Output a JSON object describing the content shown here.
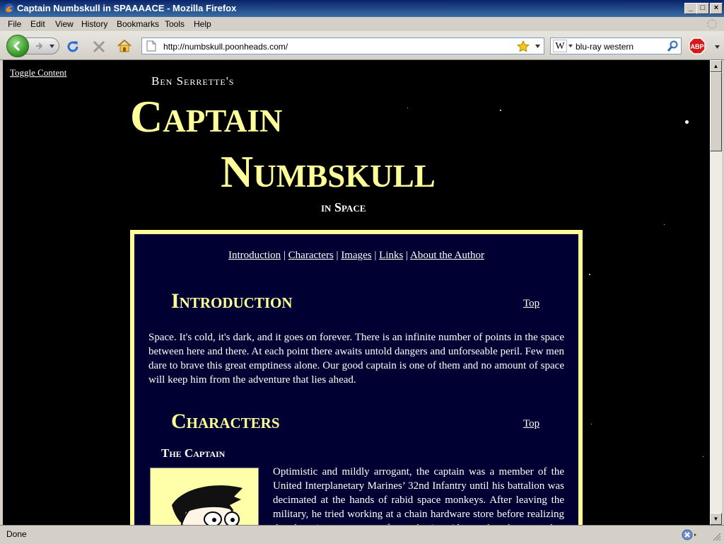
{
  "window": {
    "title": "Captain Numbskull in SPAAAACE - Mozilla Firefox"
  },
  "menu": [
    "File",
    "Edit",
    "View",
    "History",
    "Bookmarks",
    "Tools",
    "Help"
  ],
  "toolbar": {
    "url": "http://numbskull.poonheads.com/",
    "search_engine_letter": "W",
    "search_value": "blu-ray western"
  },
  "page": {
    "toggle_label": "Toggle Content",
    "byline": "Ben Serrette's",
    "title_line1": "Captain",
    "title_line2": "Numbskull",
    "title_line3": "in Space",
    "nav": [
      "Introduction",
      "Characters",
      "Images",
      "Links",
      "About the Author"
    ],
    "nav_separator": " | ",
    "intro_heading": "Introduction",
    "top_label": "Top",
    "intro_text": "Space. It's cold, it's dark, and it goes on forever. There is an infinite number of points in the space between here and there. At each point there awaits untold dangers and unforseable peril. Few men dare to brave this great emptiness alone. Our good captain is one of them and no amount of space will keep him from the adventure that lies ahead.",
    "characters_heading": "Characters",
    "captain_heading": "The Captain",
    "captain_text": "Optimistic and mildly arrogant, the captain was a member of the United Interplanetary Marines’ 32nd Infantry until his battalion was decimated at the hands of rabid space monkeys. After leaving the military, he tried working at a chain hardware store before realizing that the private sector was far too boring. Always the adventurer, he"
  },
  "status": {
    "text": "Done"
  },
  "colors": {
    "heading": "#ffff99",
    "panel_bg": "#000033",
    "page_bg": "#000000",
    "titlebar": "#0a246a"
  }
}
